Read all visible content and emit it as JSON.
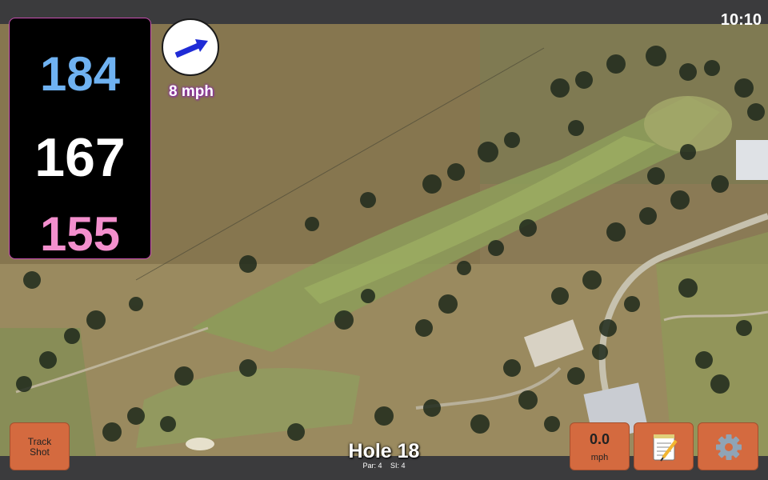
{
  "status": {
    "time": "10:10"
  },
  "distances": {
    "back": "184",
    "middle": "167",
    "front": "155"
  },
  "wind": {
    "speed_label": "8 mph",
    "icon": "wind-arrow-icon"
  },
  "buttons": {
    "track_shot_line1": "Track",
    "track_shot_line2": "Shot",
    "speed_value": "0.0",
    "speed_unit": "mph",
    "notes_icon": "notepad-icon",
    "settings_icon": "gear-icon"
  },
  "hole": {
    "title": "Hole 18",
    "par": "Par: 4",
    "si": "SI: 4"
  },
  "colors": {
    "back": "#6fb2f2",
    "middle": "#ffffff",
    "front": "#f38fcd",
    "accent": "#c94fb2",
    "button": "#d46a3f"
  }
}
